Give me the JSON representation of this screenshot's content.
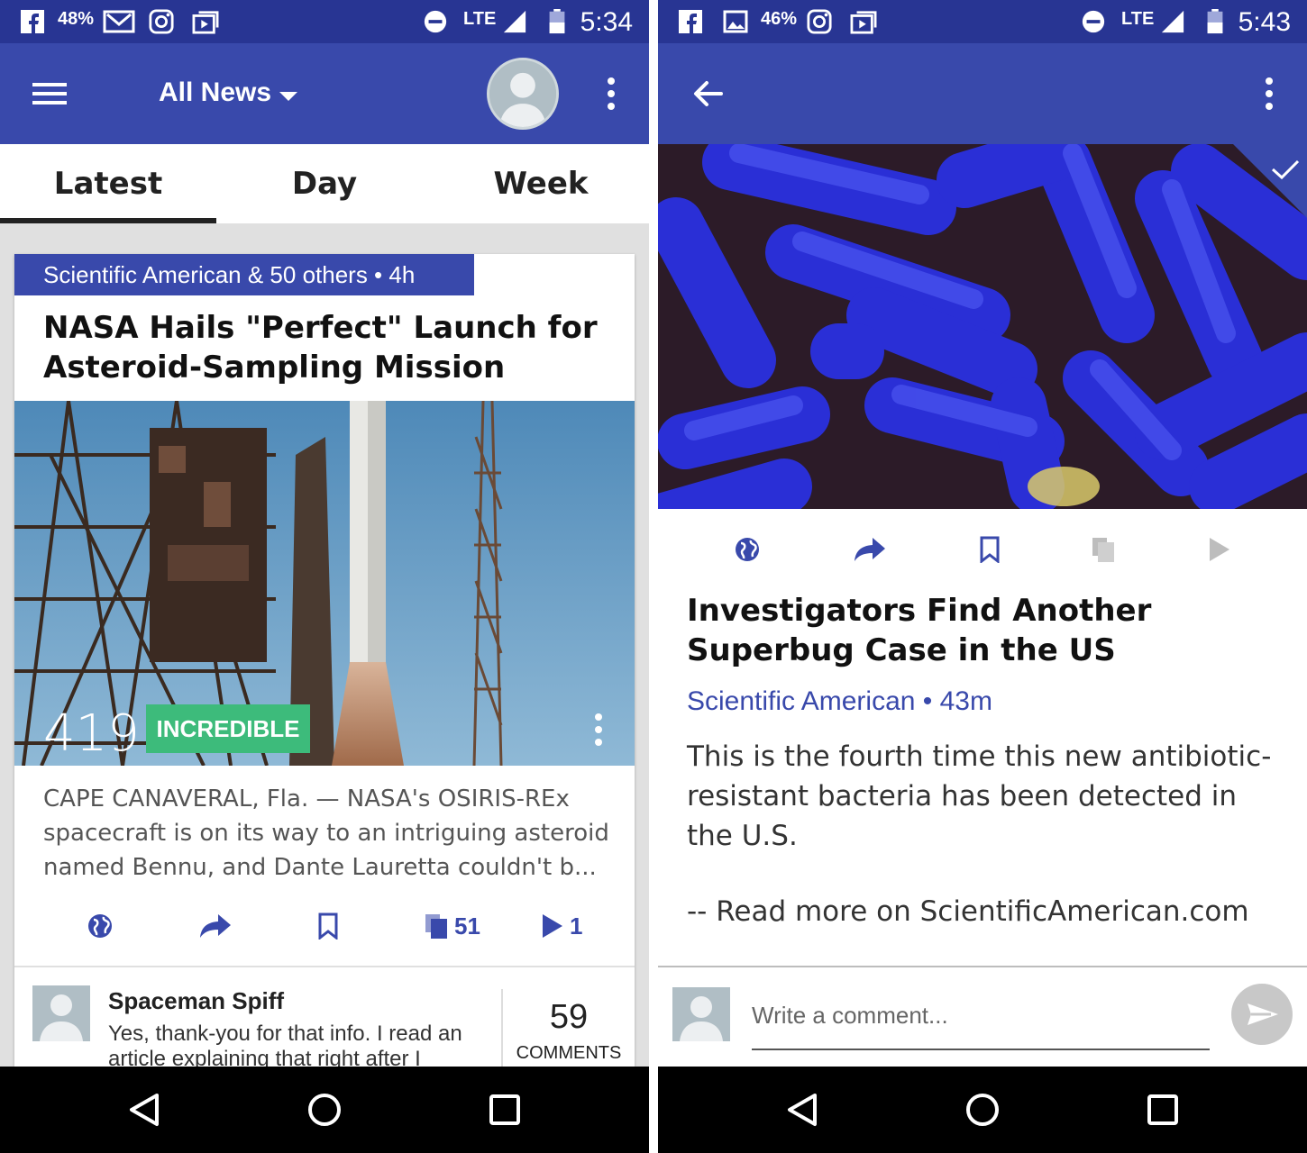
{
  "colors": {
    "status_bar": "#283593",
    "app_bar": "#3949ab",
    "accent": "#3949ab",
    "reaction_badge": "#3dbb7b",
    "nav_bar": "#000000"
  },
  "left": {
    "status_bar": {
      "battery_percent": "48%",
      "network": "LTE",
      "time": "5:34",
      "icons": [
        "facebook-icon",
        "gmail-icon",
        "instagram-icon",
        "video-icon",
        "do-not-disturb-icon",
        "signal-icon",
        "battery-icon"
      ]
    },
    "app_bar": {
      "title": "All News",
      "icons": [
        "hamburger-menu-icon",
        "caret-down-icon",
        "profile-avatar",
        "more-vert-icon"
      ]
    },
    "tabs": [
      {
        "label": "Latest",
        "selected": true
      },
      {
        "label": "Day",
        "selected": false
      },
      {
        "label": "Week",
        "selected": false
      }
    ],
    "card": {
      "source_line": "Scientific American & 50 others  •  4h",
      "title": "NASA Hails \"Perfect\" Launch for Asteroid-Sampling Mission",
      "reaction_count": "419",
      "reaction_label": "INCREDIBLE",
      "excerpt": "CAPE CANAVERAL, Fla. — NASA's OSIRIS-REx spacecraft is on its way to an intriguing asteroid named Bennu, and Dante Lauretta couldn't b...",
      "actions": [
        {
          "icon": "globe-icon",
          "count": ""
        },
        {
          "icon": "share-icon",
          "count": ""
        },
        {
          "icon": "bookmark-icon",
          "count": ""
        },
        {
          "icon": "copy-icon",
          "count": "51"
        },
        {
          "icon": "play-icon",
          "count": "1"
        }
      ],
      "comment": {
        "author": "Spaceman Spiff",
        "text": "Yes, thank-you for that info.  I read an article explaining that right after I rea..."
      },
      "comments_count": "59",
      "comments_label": "COMMENTS"
    }
  },
  "right": {
    "status_bar": {
      "battery_percent": "46%",
      "network": "LTE",
      "time": "5:43",
      "icons": [
        "facebook-icon",
        "image-icon",
        "instagram-icon",
        "video-icon",
        "do-not-disturb-icon",
        "signal-icon",
        "battery-icon"
      ]
    },
    "app_bar": {
      "icons": [
        "back-arrow-icon",
        "more-vert-icon"
      ]
    },
    "article": {
      "title": "Investigators Find Another Superbug Case in the US",
      "source": "Scientific American",
      "age": "43m",
      "source_line": "Scientific American  •  43m",
      "body": "This is the fourth time this new antibiotic-resistant bacteria has been detected in the U.S.",
      "read_more": "-- Read more on ScientificAmerican.com",
      "actions": [
        "globe-icon",
        "share-icon",
        "bookmark-icon",
        "copy-icon",
        "play-icon"
      ]
    },
    "comment_box": {
      "placeholder": "Write a comment..."
    }
  },
  "nav_bar": {
    "icons": [
      "back-triangle-icon",
      "home-circle-icon",
      "recents-square-icon"
    ]
  }
}
